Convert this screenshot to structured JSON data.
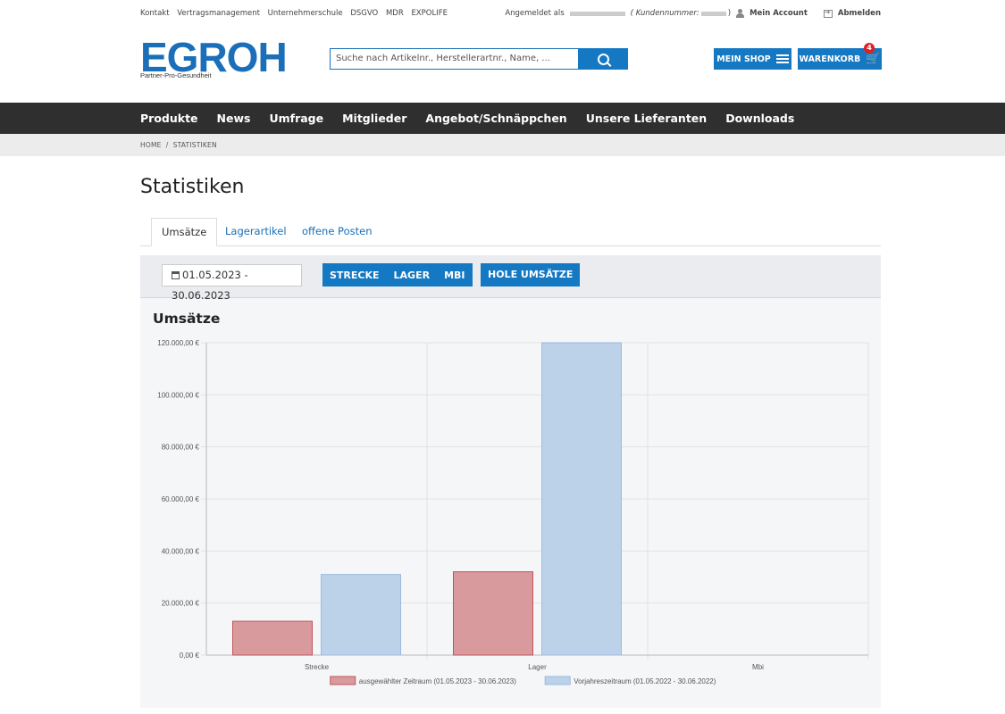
{
  "topbar": {
    "links": [
      "Kontakt",
      "Vertragsmanagement",
      "Unternehmerschule",
      "DSGVO",
      "MDR",
      "EXPOLIFE"
    ],
    "logged_in_label": "Angemeldet als",
    "customer_label": "( Kundennummer:",
    "customer_close": ")",
    "account": "Mein Account",
    "logout": "Abmelden"
  },
  "logo": {
    "text": "EGROH",
    "tagline": "Partner-Pro-Gesundheit"
  },
  "search": {
    "placeholder": "Suche nach Artikelnr., Herstellerartnr., Name, ..."
  },
  "header": {
    "shop_label": "MEIN SHOP",
    "cart_label": "WARENKORB",
    "cart_count": "4"
  },
  "nav": [
    "Produkte",
    "News",
    "Umfrage",
    "Mitglieder",
    "Angebot/Schnäppchen",
    "Unsere Lieferanten",
    "Downloads"
  ],
  "breadcrumb": {
    "home": "HOME",
    "sep": "/",
    "current": "STATISTIKEN"
  },
  "page": {
    "title": "Statistiken"
  },
  "tabs": [
    {
      "label": "Umsätze"
    },
    {
      "label": "Lagerartikel"
    },
    {
      "label": "offene Posten"
    }
  ],
  "toolbar": {
    "date_range": "01.05.2023 - 30.06.2023",
    "filters": [
      "STRECKE",
      "LAGER",
      "MBI"
    ],
    "fetch_label": "HOLE UMSÄTZE"
  },
  "colors": {
    "brand": "#1478c2",
    "series1": "#d99a9d",
    "series2": "#bcd2e8",
    "nav_bg": "#2f2f2f"
  },
  "chart_data": {
    "type": "bar",
    "title": "Umsätze",
    "categories": [
      "Strecke",
      "Lager",
      "Mbi"
    ],
    "series": [
      {
        "name": "ausgewählter Zeitraum (01.05.2023 - 30.06.2023)",
        "values": [
          13000,
          32000,
          0
        ],
        "color": "#d99a9d",
        "stroke": "#c0545c"
      },
      {
        "name": "Vorjahreszeitraum (01.05.2022 - 30.06.2022)",
        "values": [
          31000,
          120000,
          0
        ],
        "color": "#bcd2e8",
        "stroke": "#9cbbe0"
      }
    ],
    "ylim": [
      0,
      120000
    ],
    "yticks": [
      "0,00 €",
      "20.000,00 €",
      "40.000,00 €",
      "60.000,00 €",
      "80.000,00 €",
      "100.000,00 €",
      "120.000,00 €"
    ],
    "ytick_values": [
      0,
      20000,
      40000,
      60000,
      80000,
      100000,
      120000
    ],
    "grid": true,
    "legend": "bottom"
  }
}
